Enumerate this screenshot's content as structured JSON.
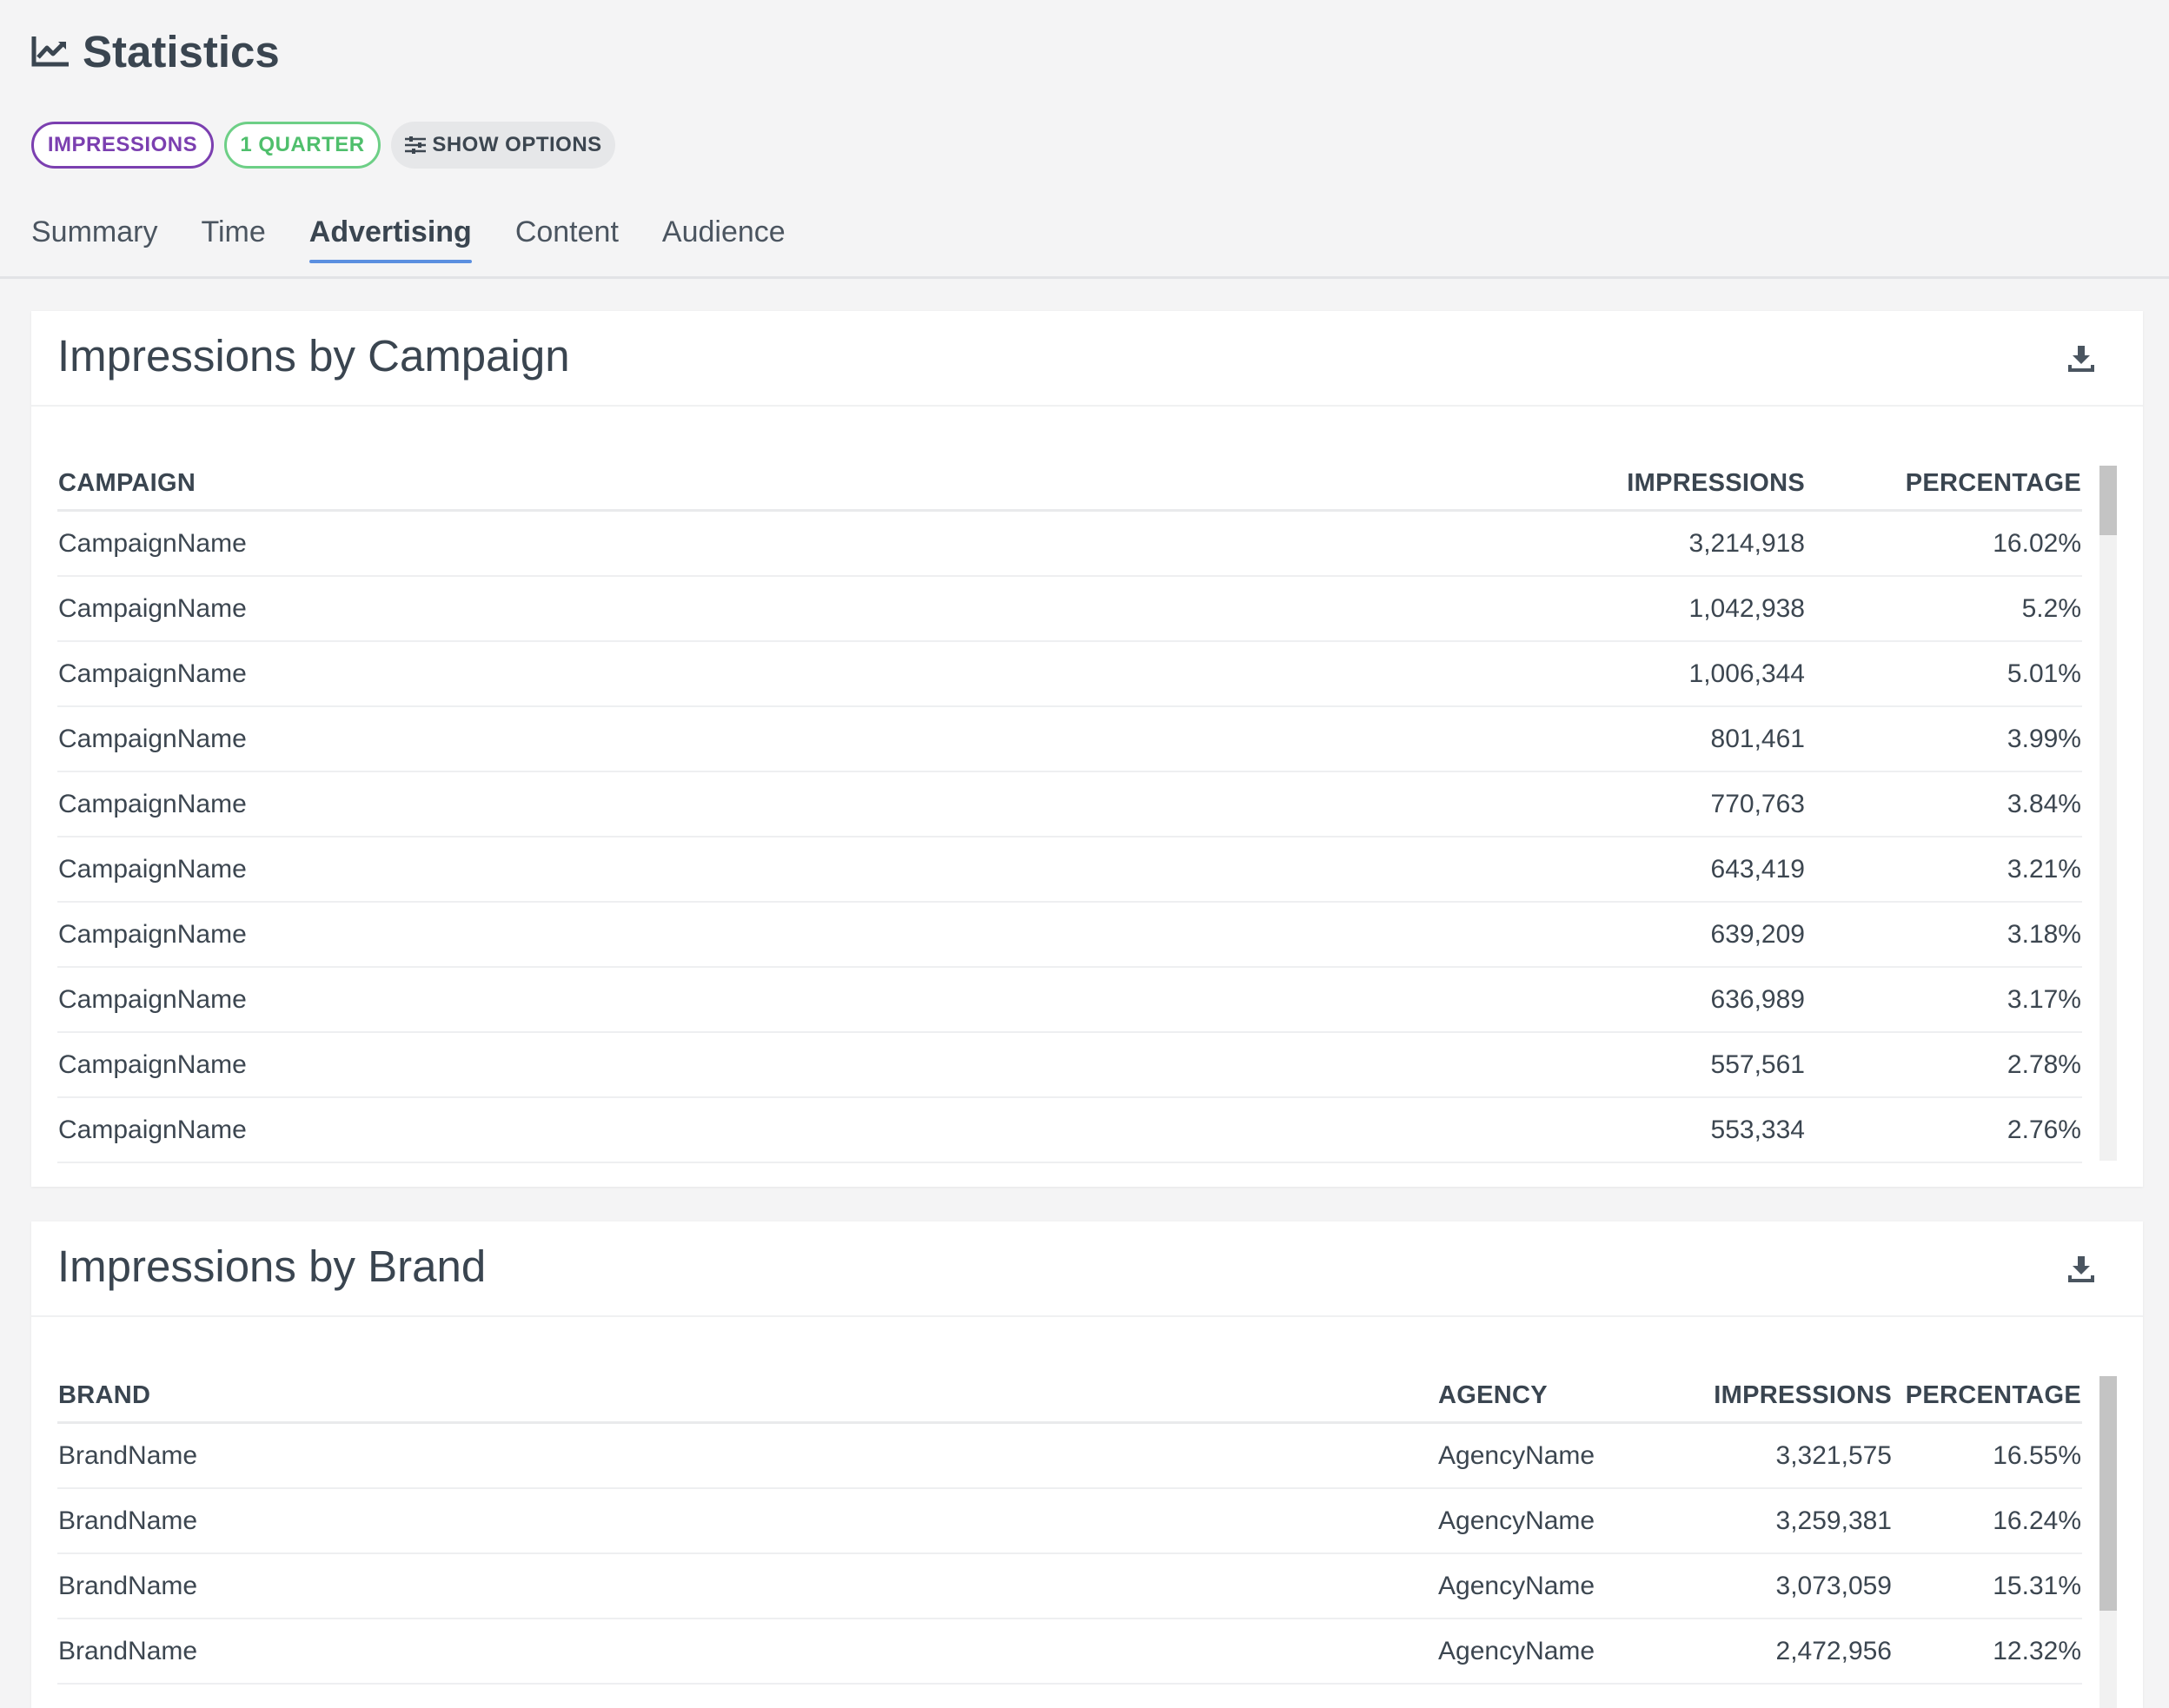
{
  "header": {
    "title": "Statistics",
    "icon": "line-chart-icon"
  },
  "filters": {
    "metric_label": "IMPRESSIONS",
    "period_label": "1 QUARTER",
    "options_label": "SHOW OPTIONS",
    "metric_color": "#7b3fb0",
    "period_color": "#4fbf6c"
  },
  "tabs": [
    {
      "label": "Summary",
      "active": false
    },
    {
      "label": "Time",
      "active": false
    },
    {
      "label": "Advertising",
      "active": true
    },
    {
      "label": "Content",
      "active": false
    },
    {
      "label": "Audience",
      "active": false
    }
  ],
  "campaign_card": {
    "title": "Impressions by Campaign",
    "columns": [
      "CAMPAIGN",
      "IMPRESSIONS",
      "PERCENTAGE"
    ],
    "rows": [
      {
        "name": "CampaignName",
        "impressions": "3,214,918",
        "percentage": "16.02%"
      },
      {
        "name": "CampaignName",
        "impressions": "1,042,938",
        "percentage": "5.2%"
      },
      {
        "name": "CampaignName",
        "impressions": "1,006,344",
        "percentage": "5.01%"
      },
      {
        "name": "CampaignName",
        "impressions": "801,461",
        "percentage": "3.99%"
      },
      {
        "name": "CampaignName",
        "impressions": "770,763",
        "percentage": "3.84%"
      },
      {
        "name": "CampaignName",
        "impressions": "643,419",
        "percentage": "3.21%"
      },
      {
        "name": "CampaignName",
        "impressions": "639,209",
        "percentage": "3.18%"
      },
      {
        "name": "CampaignName",
        "impressions": "636,989",
        "percentage": "3.17%"
      },
      {
        "name": "CampaignName",
        "impressions": "557,561",
        "percentage": "2.78%"
      },
      {
        "name": "CampaignName",
        "impressions": "553,334",
        "percentage": "2.76%"
      }
    ]
  },
  "brand_card": {
    "title": "Impressions by Brand",
    "columns": [
      "BRAND",
      "AGENCY",
      "IMPRESSIONS",
      "PERCENTAGE"
    ],
    "rows": [
      {
        "brand": "BrandName",
        "agency": "AgencyName",
        "impressions": "3,321,575",
        "percentage": "16.55%"
      },
      {
        "brand": "BrandName",
        "agency": "AgencyName",
        "impressions": "3,259,381",
        "percentage": "16.24%"
      },
      {
        "brand": "BrandName",
        "agency": "AgencyName",
        "impressions": "3,073,059",
        "percentage": "15.31%"
      },
      {
        "brand": "BrandName",
        "agency": "AgencyName",
        "impressions": "2,472,956",
        "percentage": "12.32%"
      }
    ]
  }
}
